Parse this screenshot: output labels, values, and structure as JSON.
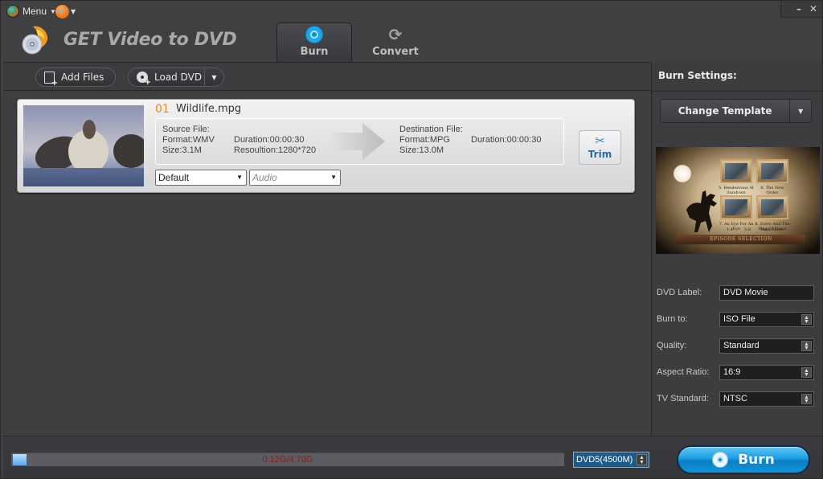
{
  "titlebar": {
    "menu_label": "Menu",
    "app_title": "GET Video to DVD",
    "minimize": "–",
    "close": "✕",
    "tabs": [
      {
        "label": "Burn",
        "icon": "burn-disc-icon",
        "active": true
      },
      {
        "label": "Convert",
        "icon": "convert-refresh-icon",
        "active": false
      }
    ]
  },
  "toolbar": {
    "add_files_label": "Add Files",
    "load_dvd_label": "Load DVD"
  },
  "file_list": [
    {
      "index": "01",
      "name": "Wildlife.mpg",
      "source": {
        "heading": "Source File:",
        "format": "Format:WMV",
        "size": "Size:3.1M",
        "duration": "Duration:00:00:30",
        "resolution": "Resoultion:1280*720"
      },
      "destination": {
        "heading": "Destination File:",
        "format": "Format:MPG",
        "size": "Size:13.0M",
        "duration": "Duration:00:00:30"
      },
      "subtitle_select": "Default",
      "audio_select": "Audio",
      "trim_label": "Trim"
    }
  ],
  "burn_settings": {
    "title": "Burn Settings:",
    "change_template_label": "Change Template",
    "template_preview": {
      "captions": [
        "5. Rendezvous At Sundown",
        "6. The New Order",
        "7. An Eye For An Eye",
        "8. Zorro And The Flag Of Truce"
      ],
      "nav": [
        "1-4",
        "5-8",
        "Main Menu"
      ],
      "banner": "EPISODE SELECTION"
    },
    "fields": [
      {
        "label": "DVD Label:",
        "value": "DVD Movie",
        "type": "text"
      },
      {
        "label": "Burn to:",
        "value": "ISO File",
        "type": "select"
      },
      {
        "label": "Quality:",
        "value": "Standard",
        "type": "select"
      },
      {
        "label": "Aspect Ratio:",
        "value": "16:9",
        "type": "select"
      },
      {
        "label": "TV Standard:",
        "value": "NTSC",
        "type": "select"
      }
    ]
  },
  "bottom": {
    "capacity_text": "0.12G/4.70G",
    "capacity_used_fraction": 0.0255,
    "disc_type": "DVD5(4500M)",
    "burn_label": "Burn"
  }
}
